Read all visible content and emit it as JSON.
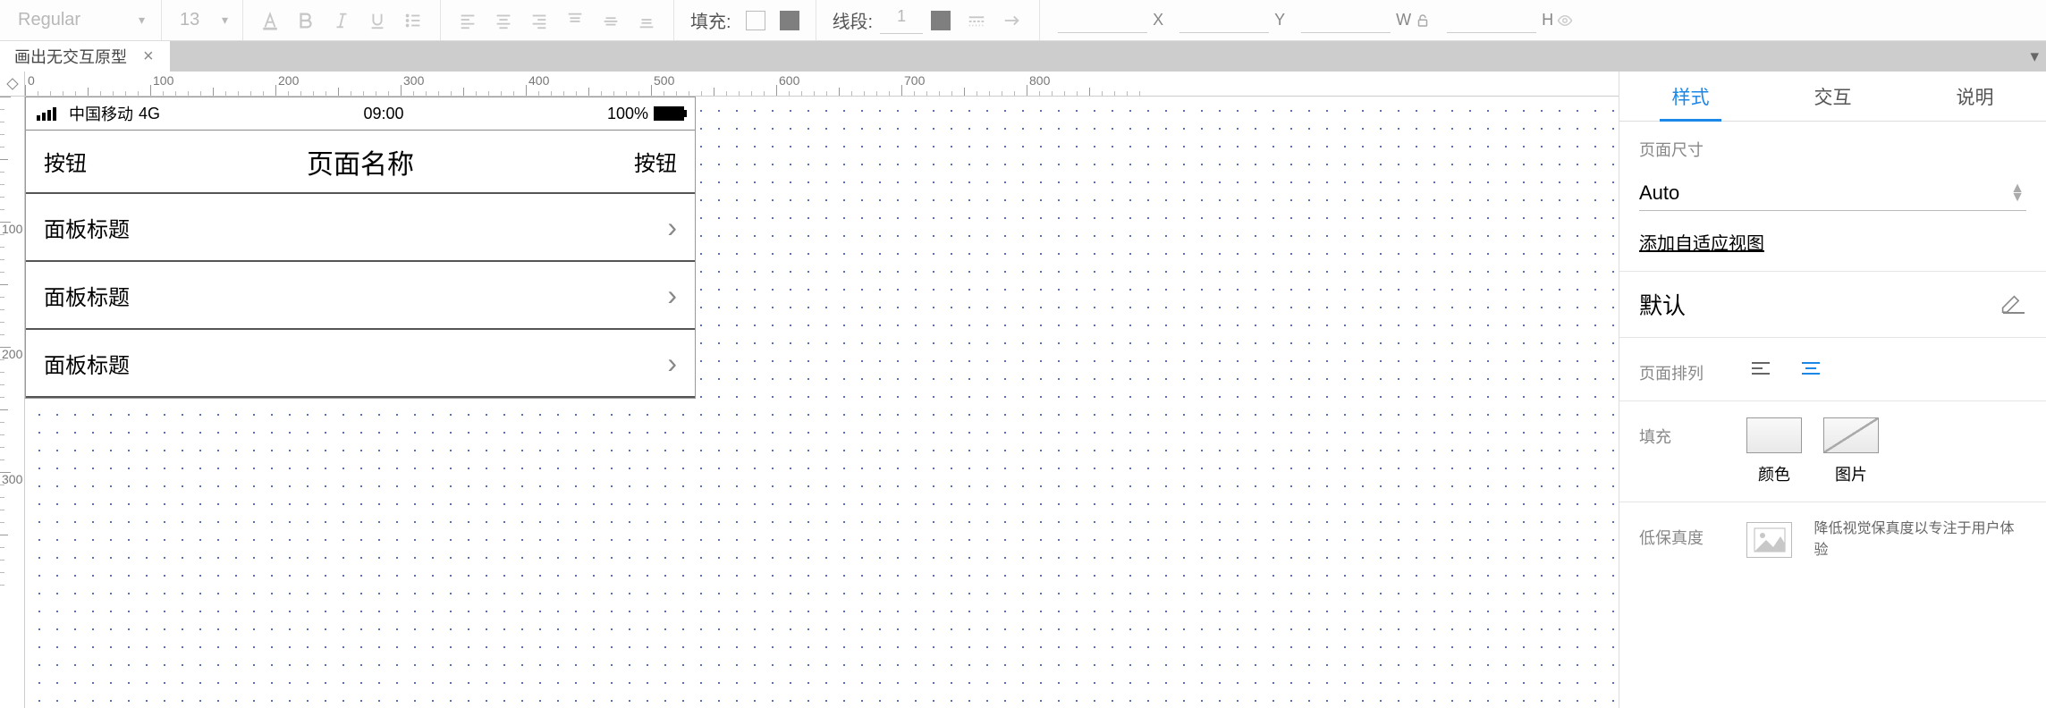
{
  "toolbar": {
    "font_family": "Regular",
    "font_size": "13",
    "fill_label": "填充:",
    "line_label": "线段:",
    "line_value": "1",
    "geom": {
      "x_label": "X",
      "y_label": "Y",
      "w_label": "W",
      "h_label": "H"
    }
  },
  "tab": {
    "title": "画出无交互原型"
  },
  "ruler_h": [
    0,
    100,
    200,
    300,
    400,
    500,
    600,
    700,
    800
  ],
  "ruler_v": [
    100,
    200,
    300
  ],
  "device": {
    "statusbar": {
      "carrier": "中国移动",
      "network": "4G",
      "time": "09:00",
      "battery": "100%"
    },
    "navbar": {
      "left": "按钮",
      "title": "页面名称",
      "right": "按钮"
    },
    "items": [
      "面板标题",
      "面板标题",
      "面板标题"
    ]
  },
  "inspector": {
    "tabs": {
      "style": "样式",
      "interact": "交互",
      "notes": "说明"
    },
    "page_size": {
      "label": "页面尺寸",
      "value": "Auto",
      "add_link": "添加自适应视图"
    },
    "default_label": "默认",
    "page_align_label": "页面排列",
    "fill": {
      "label": "填充",
      "color": "颜色",
      "image": "图片"
    },
    "lofi": {
      "label": "低保真度",
      "text": "降低视觉保真度以专注于用户体验"
    }
  }
}
